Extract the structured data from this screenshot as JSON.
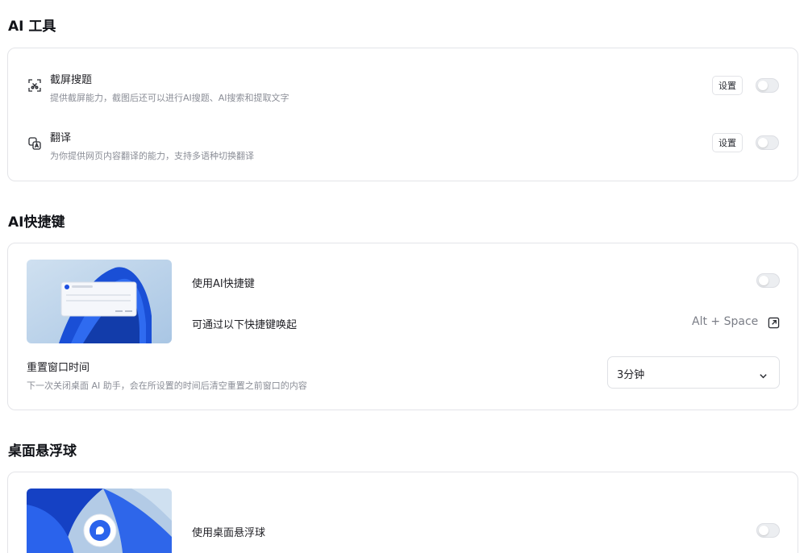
{
  "sections": {
    "ai_tools": {
      "title": "AI 工具",
      "items": [
        {
          "title": "截屏搜题",
          "desc": "提供截屏能力，截图后还可以进行AI搜题、AI搜索和提取文字",
          "button": "设置",
          "enabled": false,
          "icon": "screenshot-icon"
        },
        {
          "title": "翻译",
          "desc": "为你提供网页内容翻译的能力，支持多语种切换翻译",
          "button": "设置",
          "enabled": false,
          "icon": "translate-icon"
        }
      ]
    },
    "ai_shortcut": {
      "title": "AI快捷键",
      "use_label": "使用AI快捷键",
      "use_enabled": false,
      "wake_label": "可通过以下快捷键唤起",
      "shortcut": "Alt + Space",
      "shortcut_icon": "open-external-icon",
      "reset_title": "重置窗口时间",
      "reset_desc": "下一次关闭桌面 AI 助手，会在所设置的时间后清空重置之前窗口的内容",
      "reset_value": "3分钟"
    },
    "float_ball": {
      "title": "桌面悬浮球",
      "use_label": "使用桌面悬浮球",
      "use_enabled": false
    }
  },
  "colors": {
    "accent": "#1d4fe0",
    "toggle_off": "#eceef1",
    "text_muted": "#8a8d96"
  }
}
